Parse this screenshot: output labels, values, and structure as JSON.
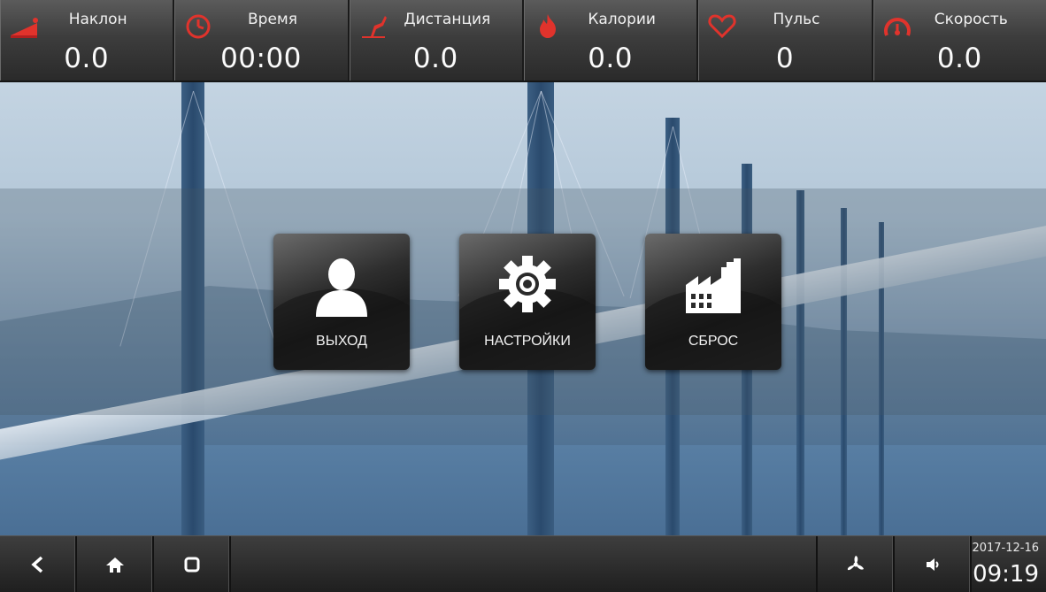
{
  "stats": [
    {
      "label": "Наклон",
      "value": "0.0",
      "icon": "incline-icon"
    },
    {
      "label": "Время",
      "value": "00:00",
      "icon": "clock-icon"
    },
    {
      "label": "Дистанция",
      "value": "0.0",
      "icon": "distance-icon"
    },
    {
      "label": "Калории",
      "value": "0.0",
      "icon": "flame-icon"
    },
    {
      "label": "Пульс",
      "value": "0",
      "icon": "heart-icon"
    },
    {
      "label": "Скорость",
      "value": "0.0",
      "icon": "speedometer-icon"
    }
  ],
  "menu": {
    "exit": {
      "label": "ВЫХОД",
      "icon": "user-icon"
    },
    "settings": {
      "label": "НАСТРОЙКИ",
      "icon": "gear-icon"
    },
    "reset": {
      "label": "СБРОС",
      "icon": "factory-icon"
    }
  },
  "nav": {
    "back_icon": "back-icon",
    "home_icon": "home-icon",
    "recent_icon": "recent-apps-icon",
    "fan_icon": "fan-icon",
    "volume_icon": "volume-icon"
  },
  "status": {
    "date": "2017-12-16",
    "time": "09:19"
  },
  "colors": {
    "stat_icon": "#e0332c",
    "bar_dark": "#1f1f1f",
    "text": "#ffffff"
  }
}
